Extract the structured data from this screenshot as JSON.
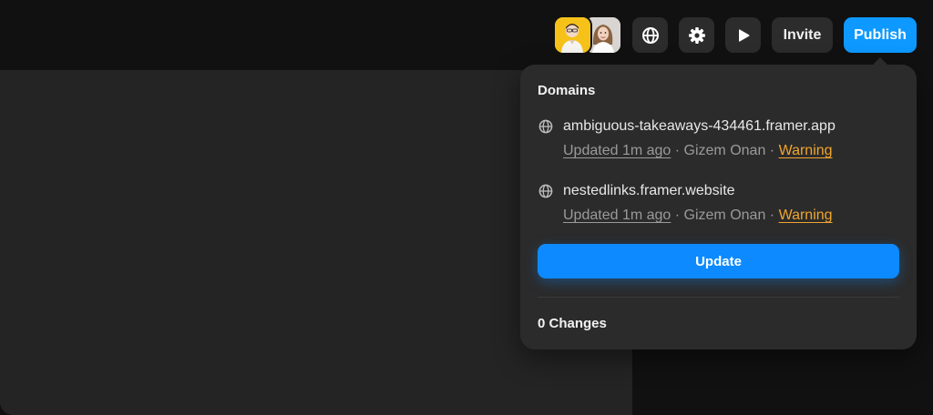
{
  "toolbar": {
    "avatars": [
      {
        "name": "collaborator-avatar-1",
        "color": "#f6c21a"
      },
      {
        "name": "collaborator-avatar-2",
        "color": "#d9d5d2"
      }
    ],
    "globe_icon": "globe-icon",
    "settings_icon": "gear-icon",
    "play_icon": "play-icon",
    "invite_label": "Invite",
    "publish_label": "Publish",
    "accent": "#0d99ff"
  },
  "popover": {
    "title": "Domains",
    "domains": [
      {
        "name": "ambiguous-takeaways-434461.framer.app",
        "updated": "Updated 1m ago",
        "sep1": " · ",
        "author": "Gizem Onan",
        "sep2": " · ",
        "status": "Warning"
      },
      {
        "name": "nestedlinks.framer.website",
        "updated": "Updated 1m ago",
        "sep1": " · ",
        "author": "Gizem Onan",
        "sep2": " · ",
        "status": "Warning"
      }
    ],
    "update_label": "Update",
    "changes_label": "0 Changes",
    "warning_color": "#f0a52f"
  }
}
